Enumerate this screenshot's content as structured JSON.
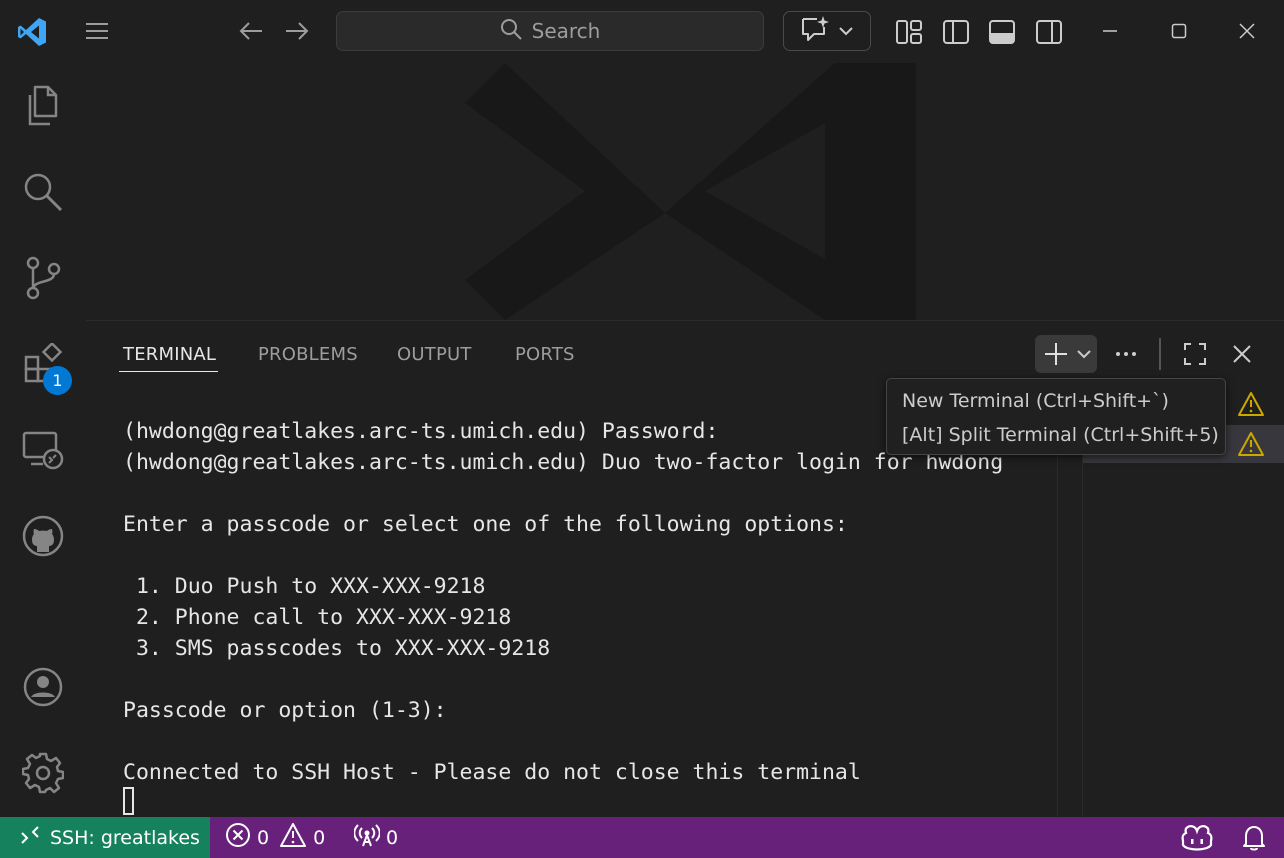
{
  "titlebar": {
    "search_placeholder": "Search",
    "icons": [
      "vscode-logo",
      "menu-icon",
      "back-arrow-icon",
      "forward-arrow-icon",
      "search-icon",
      "copilot-chat-icon",
      "chevron-down-icon",
      "customize-layout-icon",
      "toggle-primary-sidebar-icon",
      "toggle-panel-icon",
      "toggle-secondary-sidebar-icon",
      "minimize-icon",
      "maximize-icon",
      "close-icon"
    ]
  },
  "activity_bar": {
    "items": [
      "explorer",
      "search",
      "source-control",
      "extensions",
      "remote-explorer",
      "github"
    ],
    "extensions_badge": "1",
    "bottom": [
      "accounts",
      "manage"
    ]
  },
  "panel": {
    "tabs": [
      {
        "label": "TERMINAL",
        "active": true
      },
      {
        "label": "PROBLEMS",
        "active": false
      },
      {
        "label": "OUTPUT",
        "active": false
      },
      {
        "label": "PORTS",
        "active": false
      }
    ]
  },
  "terminal": {
    "lines": [
      "(hwdong@greatlakes.arc-ts.umich.edu) Password:",
      "(hwdong@greatlakes.arc-ts.umich.edu) Duo two-factor login for hwdong",
      "",
      "Enter a passcode or select one of the following options:",
      "",
      " 1. Duo Push to XXX-XXX-9218",
      " 2. Phone call to XXX-XXX-9218",
      " 3. SMS passcodes to XXX-XXX-9218",
      "",
      "Passcode or option (1-3):",
      "",
      "Connected to SSH Host - Please do not close this terminal"
    ]
  },
  "tooltip": {
    "items": [
      "New Terminal (Ctrl+Shift+`)",
      "[Alt] Split Terminal (Ctrl+Shift+5)"
    ]
  },
  "statusbar": {
    "remote": "SSH: greatlakes",
    "errors": "0",
    "warnings": "0",
    "ports": "0"
  },
  "colors": {
    "statusbar": "#68217a",
    "remote": "#16825d",
    "badge": "#0078d4",
    "warning": "#cca700"
  }
}
